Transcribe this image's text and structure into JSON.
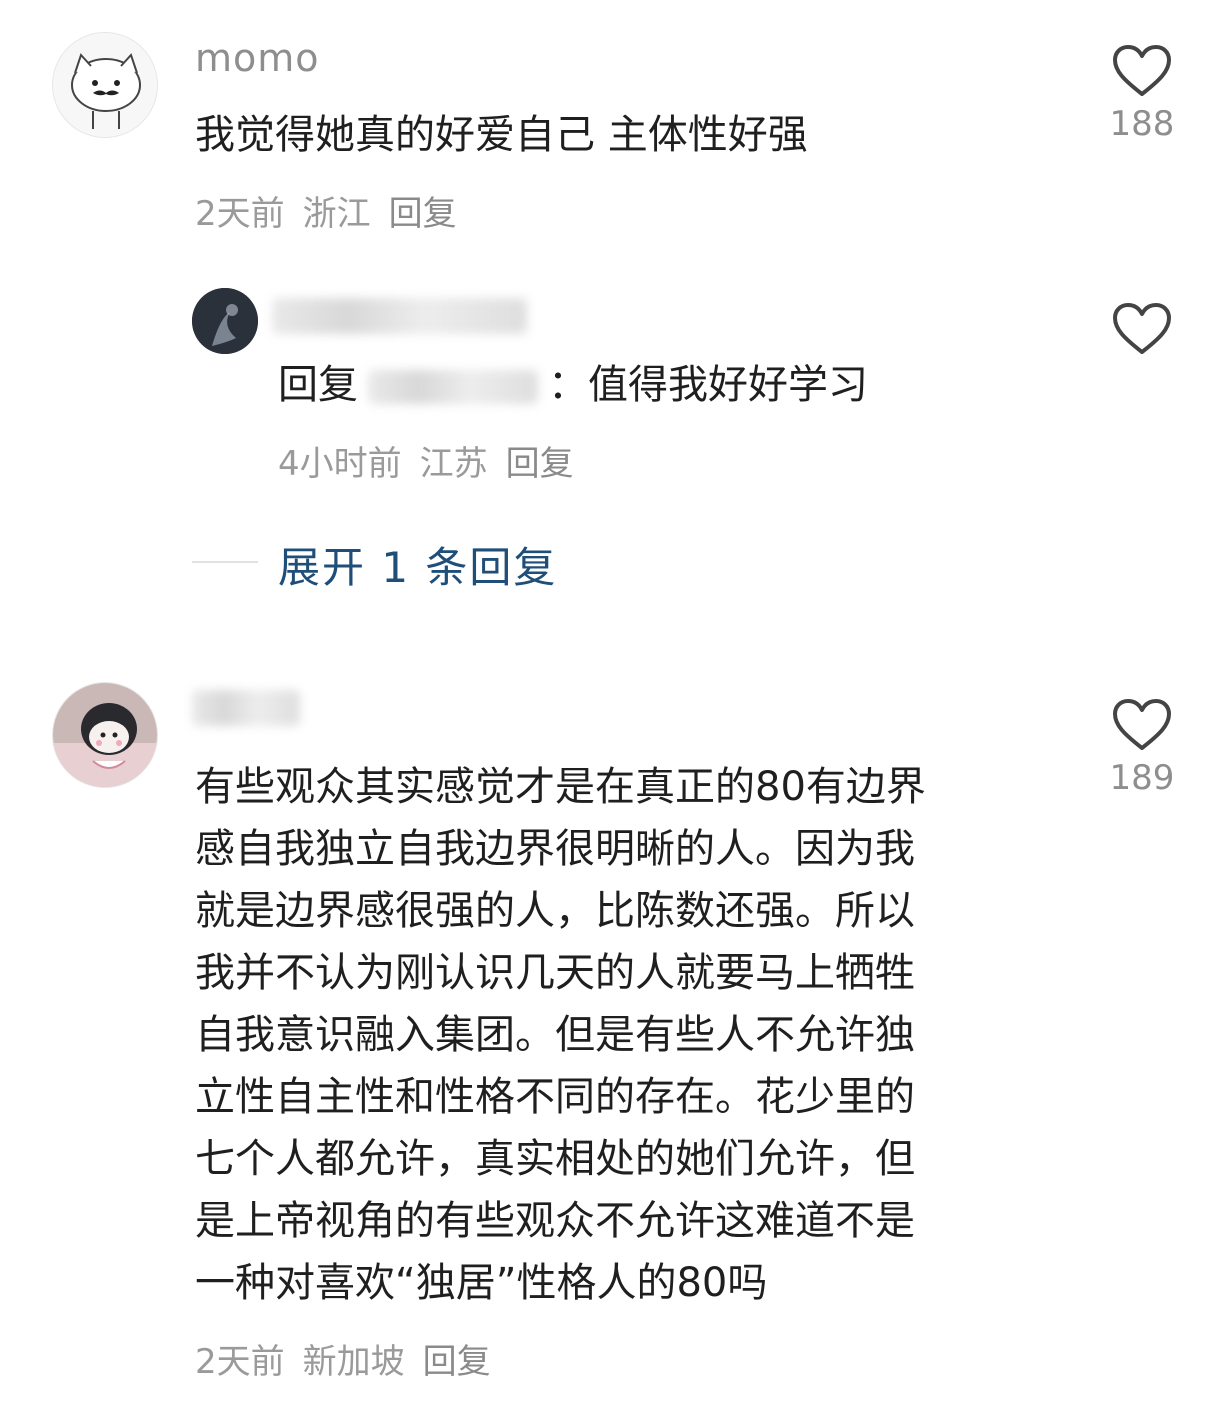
{
  "comments": [
    {
      "username": "momo",
      "content": "我觉得她真的好爱自己 主体性好强",
      "time": "2天前",
      "location": "浙江",
      "reply_label": "回复",
      "likes": "188"
    },
    {
      "username": "",
      "content_lines": [
        "有些观众其实感觉才是在真正的80有边界",
        "感自我独立自我边界很明晰的人。因为我",
        "就是边界感很强的人，比陈数还强。所以",
        "我并不认为刚认识几天的人就要马上牺牲",
        "自我意识融入集团。但是有些人不允许独",
        "立性自主性和性格不同的存在。花少里的",
        "七个人都允许，真实相处的她们允许，但",
        "是上帝视角的有些观众不允许这难道不是",
        "一种对喜欢“独居”性格人的80吗"
      ],
      "time": "2天前",
      "location": "新加坡",
      "reply_label": "回复",
      "likes": "189"
    }
  ],
  "sub_reply": {
    "prefix": "回复",
    "content": "：值得我好好学习",
    "time": "4小时前",
    "location": "江苏",
    "reply_label": "回复"
  },
  "expand": {
    "label": "展开 1 条回复"
  },
  "colors": {
    "meta": "#9a9a9a",
    "link": "#1f4e79"
  },
  "icons": {
    "like": "heart-outline-icon"
  }
}
